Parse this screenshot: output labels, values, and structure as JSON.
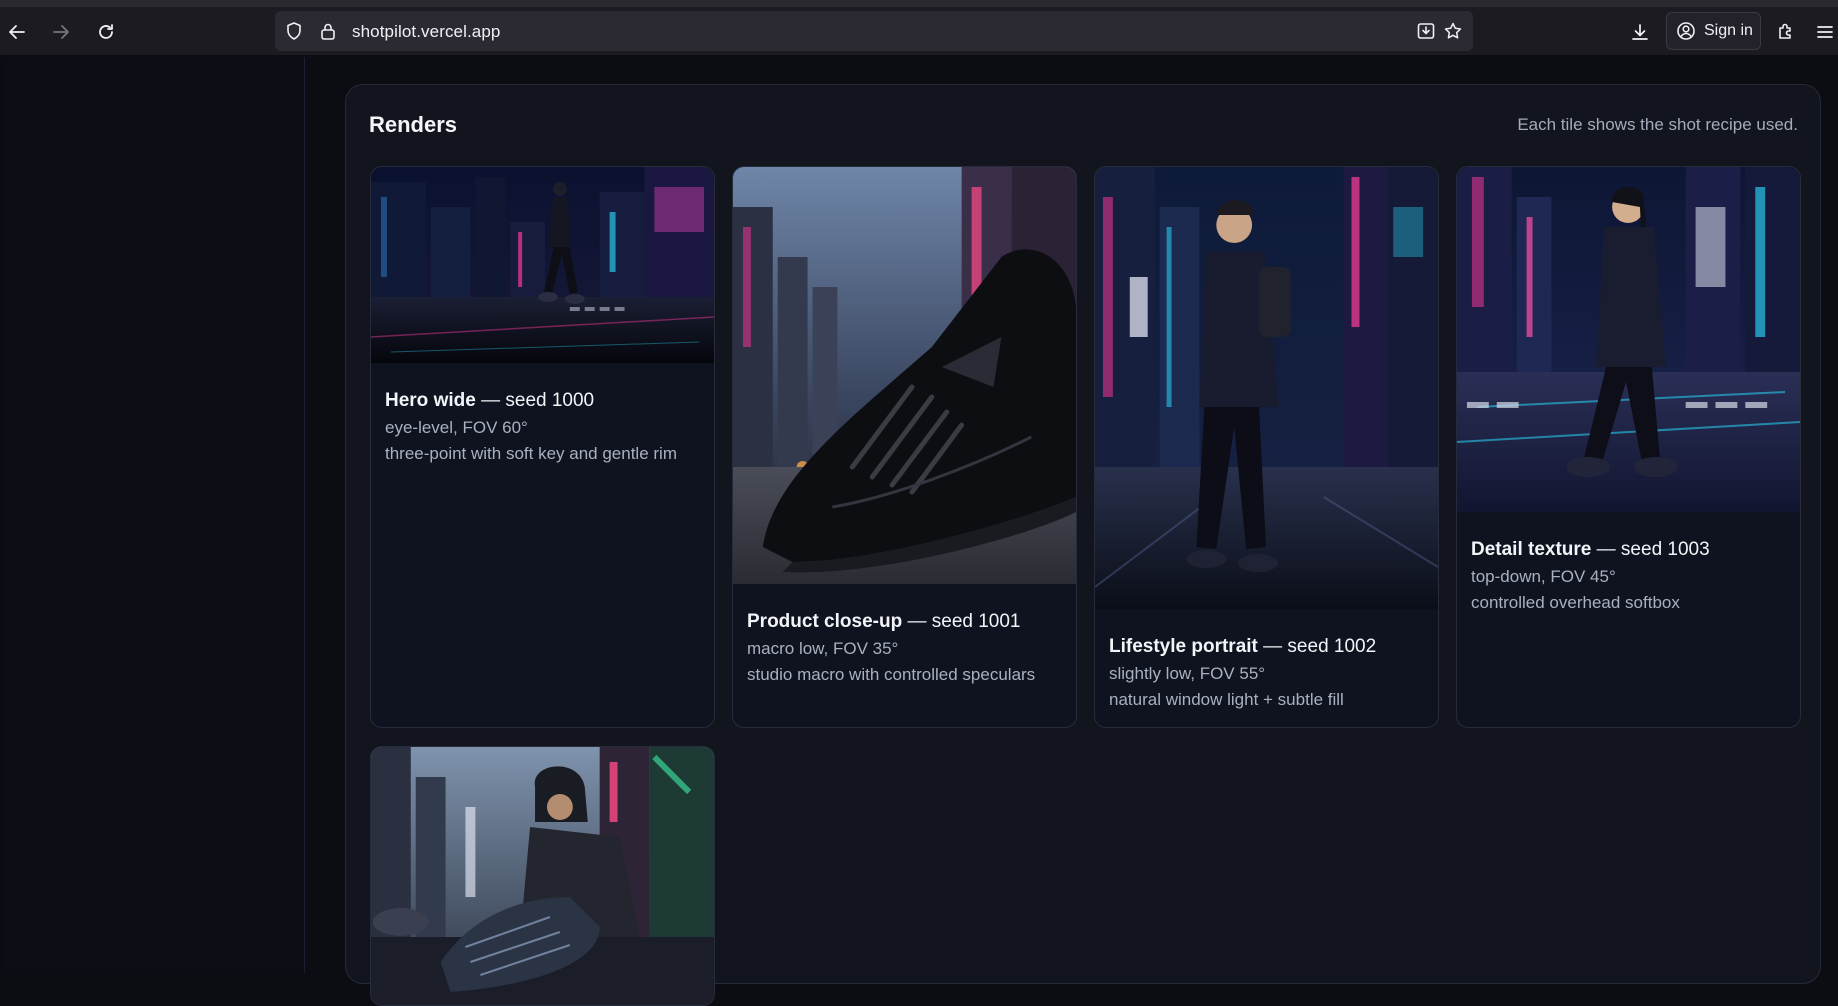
{
  "browser": {
    "url": "shotpilot.vercel.app",
    "sign_in_label": "Sign in"
  },
  "panel": {
    "title": "Renders",
    "note": "Each tile shows the shot recipe used."
  },
  "renders": [
    {
      "name": "Hero wide",
      "seed_text": "— seed 1000",
      "camera": "eye-level, FOV 60°",
      "lighting": "three-point with soft key and gentle rim"
    },
    {
      "name": "Product close-up",
      "seed_text": "— seed 1001",
      "camera": "macro low, FOV 35°",
      "lighting": "studio macro with controlled speculars"
    },
    {
      "name": "Lifestyle portrait",
      "seed_text": "— seed 1002",
      "camera": "slightly low, FOV 55°",
      "lighting": "natural window light + subtle fill"
    },
    {
      "name": "Detail texture",
      "seed_text": "— seed 1003",
      "camera": "top-down, FOV 45°",
      "lighting": "controlled overhead softbox"
    }
  ],
  "colors": {
    "accent_neon_pink": "#e0338f",
    "accent_neon_cyan": "#28c8e8",
    "panel_bg": "#12151d"
  }
}
